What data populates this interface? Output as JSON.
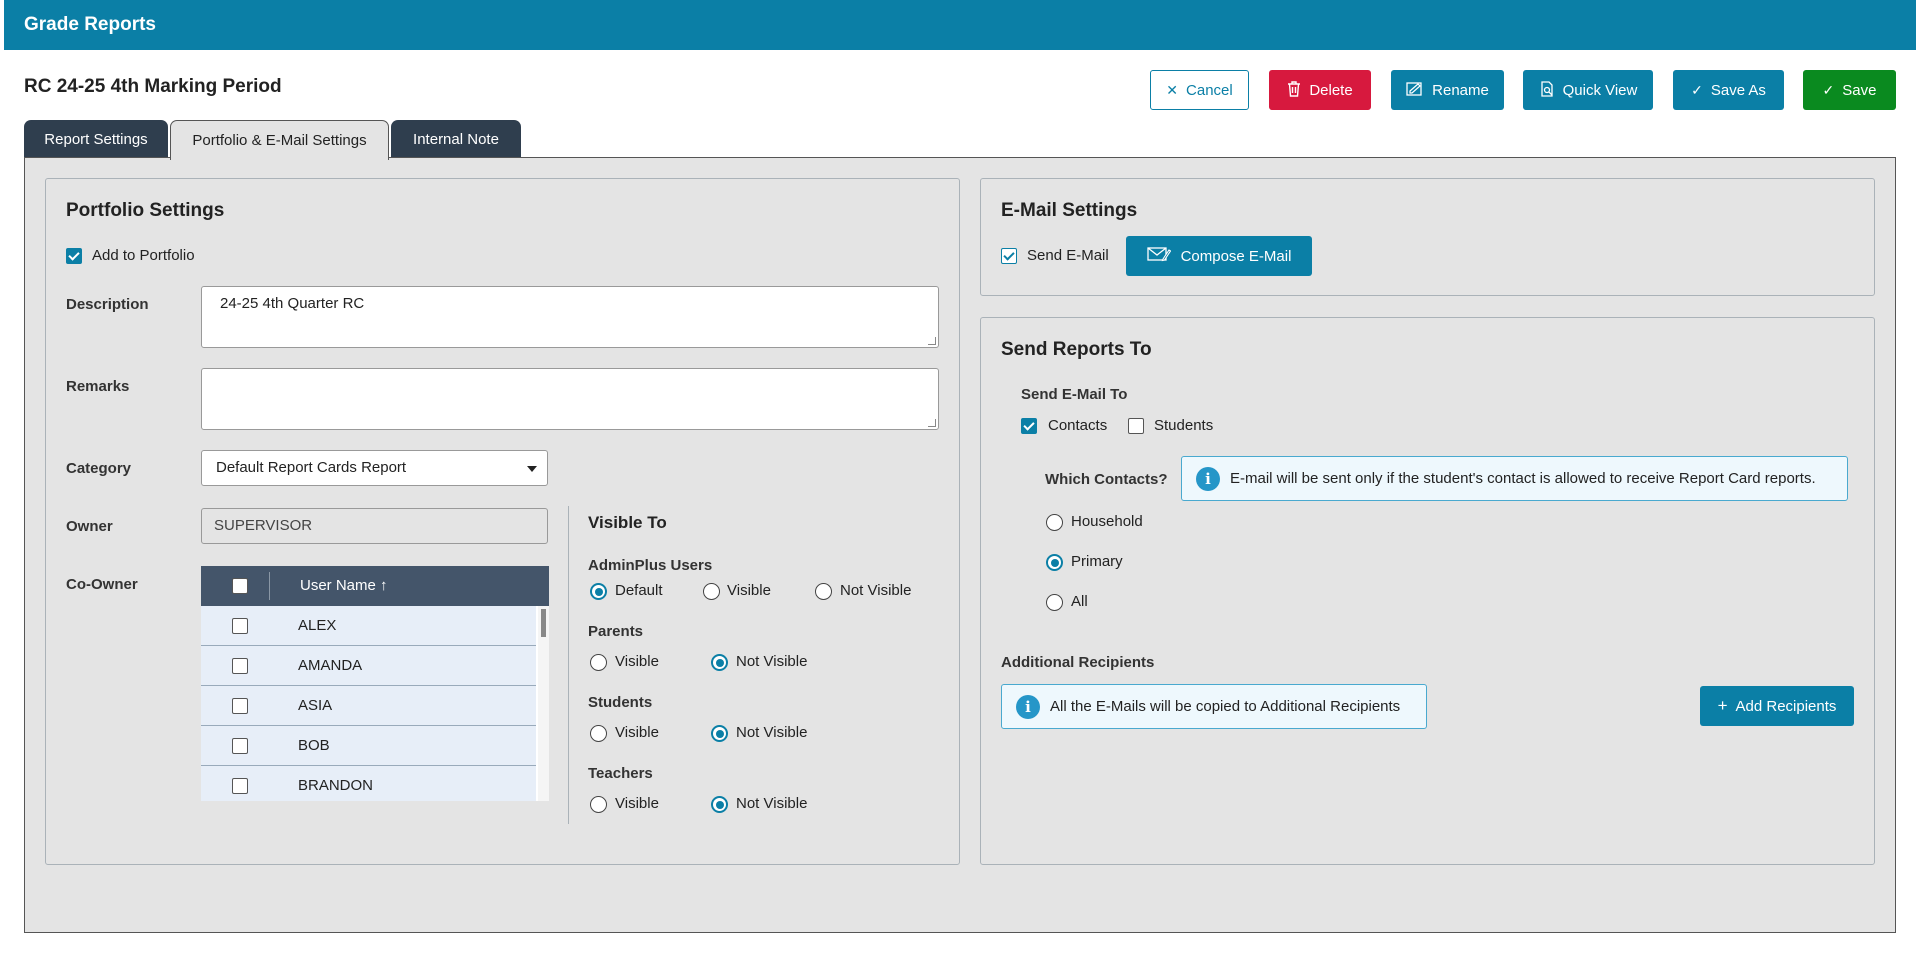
{
  "app": {
    "title": "Grade Reports"
  },
  "report": {
    "name": "RC 24-25 4th Marking Period"
  },
  "toolbar": {
    "cancel": "Cancel",
    "delete": "Delete",
    "rename": "Rename",
    "quick_view": "Quick View",
    "save_as": "Save As",
    "save": "Save"
  },
  "tabs": [
    {
      "label": "Report Settings",
      "active": false
    },
    {
      "label": "Portfolio & E-Mail Settings",
      "active": true
    },
    {
      "label": "Internal Note",
      "active": false
    }
  ],
  "portfolio": {
    "title": "Portfolio Settings",
    "add_to_portfolio": {
      "label": "Add to Portfolio",
      "checked": true
    },
    "description": {
      "label": "Description",
      "value": "24-25 4th Quarter RC"
    },
    "remarks": {
      "label": "Remarks",
      "value": ""
    },
    "category": {
      "label": "Category",
      "value": "Default Report Cards Report"
    },
    "owner": {
      "label": "Owner",
      "value": "SUPERVISOR"
    },
    "co_owner": {
      "label": "Co-Owner",
      "column_header": "User Name ↑",
      "rows": [
        "ALEX",
        "AMANDA",
        "ASIA",
        "BOB",
        "BRANDON"
      ]
    }
  },
  "visible_to": {
    "title": "Visible To",
    "groups": [
      {
        "label": "AdminPlus Users",
        "options": [
          "Default",
          "Visible",
          "Not Visible"
        ],
        "selected": "Default"
      },
      {
        "label": "Parents",
        "options": [
          "Visible",
          "Not Visible"
        ],
        "selected": "Not Visible"
      },
      {
        "label": "Students",
        "options": [
          "Visible",
          "Not Visible"
        ],
        "selected": "Not Visible"
      },
      {
        "label": "Teachers",
        "options": [
          "Visible",
          "Not Visible"
        ],
        "selected": "Not Visible"
      }
    ]
  },
  "email_settings": {
    "title": "E-Mail Settings",
    "send_email": {
      "label": "Send E-Mail",
      "checked": true
    },
    "compose": "Compose E-Mail"
  },
  "send_reports": {
    "title": "Send Reports To",
    "send_email_to": "Send E-Mail To",
    "contacts": {
      "label": "Contacts",
      "checked": true
    },
    "students": {
      "label": "Students",
      "checked": false
    },
    "which_contacts": "Which Contacts?",
    "contacts_info": "E-mail will be sent only if the student's contact is allowed to receive Report Card reports.",
    "contact_options": [
      "Household",
      "Primary",
      "All"
    ],
    "contact_selected": "Primary",
    "additional_recipients": "Additional Recipients",
    "additional_info": "All the E-Mails will be copied to Additional Recipients",
    "add_recipients": "Add Recipients"
  },
  "colors": {
    "header": "#0b7fa6",
    "primary": "#0b7fa6",
    "danger": "#d7193e",
    "success": "#0a8a1f",
    "tab_dark": "#2f3e4e"
  }
}
